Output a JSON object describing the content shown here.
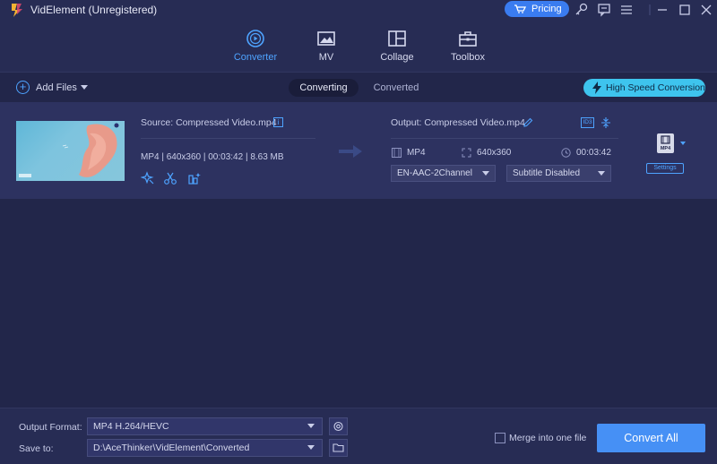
{
  "window": {
    "title": "VidElement (Unregistered)",
    "pricing_label": "Pricing"
  },
  "nav": {
    "tabs": [
      {
        "label": "Converter",
        "active": true
      },
      {
        "label": "MV"
      },
      {
        "label": "Collage"
      },
      {
        "label": "Toolbox"
      }
    ]
  },
  "toolbar": {
    "add_files": "Add Files",
    "converting": "Converting",
    "converted": "Converted",
    "high_speed": "High Speed Conversion"
  },
  "file": {
    "source_name": "Source: Compressed Video.mp4",
    "info_icon": "i",
    "source_meta": "MP4 | 640x360 | 00:03:42 | 8.63 MB",
    "output_name": "Output: Compressed Video.mp4",
    "id3_label": "ID3",
    "out_format": "MP4",
    "out_resolution": "640x360",
    "out_duration": "00:03:42",
    "audio_track": "EN-AAC-2Channel",
    "subtitle": "Subtitle Disabled",
    "format_badge": "MP4",
    "settings_label": "Settings"
  },
  "bottom": {
    "output_format_label": "Output Format:",
    "output_format_value": "MP4 H.264/HEVC",
    "save_to_label": "Save to:",
    "save_to_value": "D:\\AceThinker\\VidElement\\Converted",
    "merge_label": "Merge into one file",
    "convert_all": "Convert All"
  },
  "colors": {
    "background": "#22264a",
    "accent": "#4ea3ff",
    "high_speed_button": "#3ec4ee",
    "convert_button": "#4690f5"
  }
}
